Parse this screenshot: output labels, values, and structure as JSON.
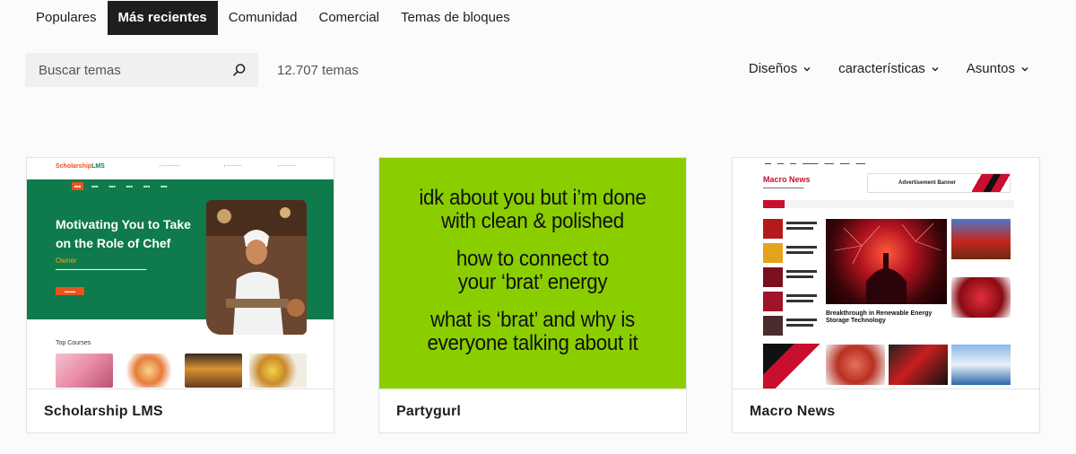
{
  "tabs": [
    {
      "label": "Populares",
      "active": false
    },
    {
      "label": "Más recientes",
      "active": true
    },
    {
      "label": "Comunidad",
      "active": false
    },
    {
      "label": "Comercial",
      "active": false
    },
    {
      "label": "Temas de bloques",
      "active": false
    }
  ],
  "search": {
    "placeholder": "Buscar temas",
    "value": ""
  },
  "count_text": "12.707 temas",
  "filters": {
    "designs": "Diseños",
    "features": "características",
    "subjects": "Asuntos"
  },
  "colors": {
    "dark": "#1e1e1e",
    "party_green": "#8ace00",
    "scholar_green": "#0f7a4b",
    "news_red": "#c8102e"
  },
  "themes": [
    {
      "name": "Scholarship LMS",
      "preview": {
        "logo_prefix": "Scholarship",
        "logo_suffix": "LMS",
        "headline": "Motivating You to Take on the Role of Chef",
        "accent": "Owner",
        "section": "Top Courses"
      }
    },
    {
      "name": "Partygurl",
      "preview": {
        "lines": [
          "idk about you but i’m done",
          "with clean & polished",
          "how to connect to",
          "your ‘brat’ energy",
          "what is ‘brat’ and why is",
          "everyone talking about it"
        ]
      }
    },
    {
      "name": "Macro News",
      "preview": {
        "site_title": "Macro News",
        "ad_text": "Advertisement Banner",
        "headline": "Breakthrough in Renewable Energy Storage Technology"
      }
    }
  ]
}
